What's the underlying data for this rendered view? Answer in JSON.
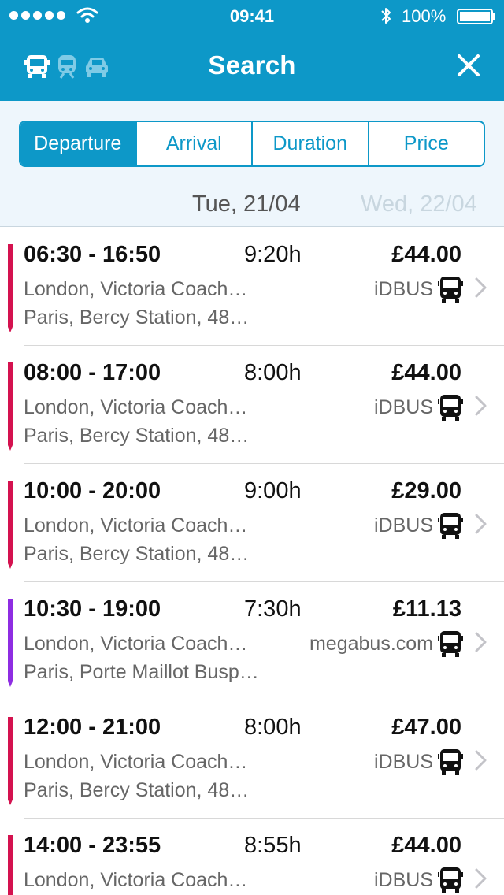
{
  "status_bar": {
    "time": "09:41",
    "battery": "100%"
  },
  "header": {
    "title": "Search",
    "mode_icons": [
      "bus-icon",
      "train-icon",
      "car-icon"
    ],
    "close_icon": "close-icon",
    "background_color": "#0d98c8"
  },
  "sort_tabs": [
    {
      "label": "Departure",
      "active": true
    },
    {
      "label": "Arrival",
      "active": false
    },
    {
      "label": "Duration",
      "active": false
    },
    {
      "label": "Price",
      "active": false
    }
  ],
  "dates": {
    "current": "Tue, 21/04",
    "next": "Wed, 22/04"
  },
  "results": [
    {
      "times": "06:30 - 16:50",
      "duration": "9:20h",
      "price": "£44.00",
      "from": "London, Victoria Coach…",
      "to": "Paris, Bercy Station, 48…",
      "operator": "iDBUS",
      "color": "#d4124f"
    },
    {
      "times": "08:00 - 17:00",
      "duration": "8:00h",
      "price": "£44.00",
      "from": "London, Victoria Coach…",
      "to": "Paris, Bercy Station, 48…",
      "operator": "iDBUS",
      "color": "#d4124f"
    },
    {
      "times": "10:00 - 20:00",
      "duration": "9:00h",
      "price": "£29.00",
      "from": "London, Victoria Coach…",
      "to": "Paris, Bercy Station, 48…",
      "operator": "iDBUS",
      "color": "#d4124f"
    },
    {
      "times": "10:30 - 19:00",
      "duration": "7:30h",
      "price": "£11.13",
      "from": "London, Victoria Coach…",
      "to": "Paris, Porte Maillot Busp…",
      "operator": "megabus.com",
      "color": "#8e2de2"
    },
    {
      "times": "12:00 - 21:00",
      "duration": "8:00h",
      "price": "£47.00",
      "from": "London, Victoria Coach…",
      "to": "Paris, Bercy Station, 48…",
      "operator": "iDBUS",
      "color": "#d4124f"
    },
    {
      "times": "14:00 - 23:55",
      "duration": "8:55h",
      "price": "£44.00",
      "from": "London, Victoria Coach…",
      "to": "",
      "operator": "iDBUS",
      "color": "#d4124f"
    }
  ]
}
